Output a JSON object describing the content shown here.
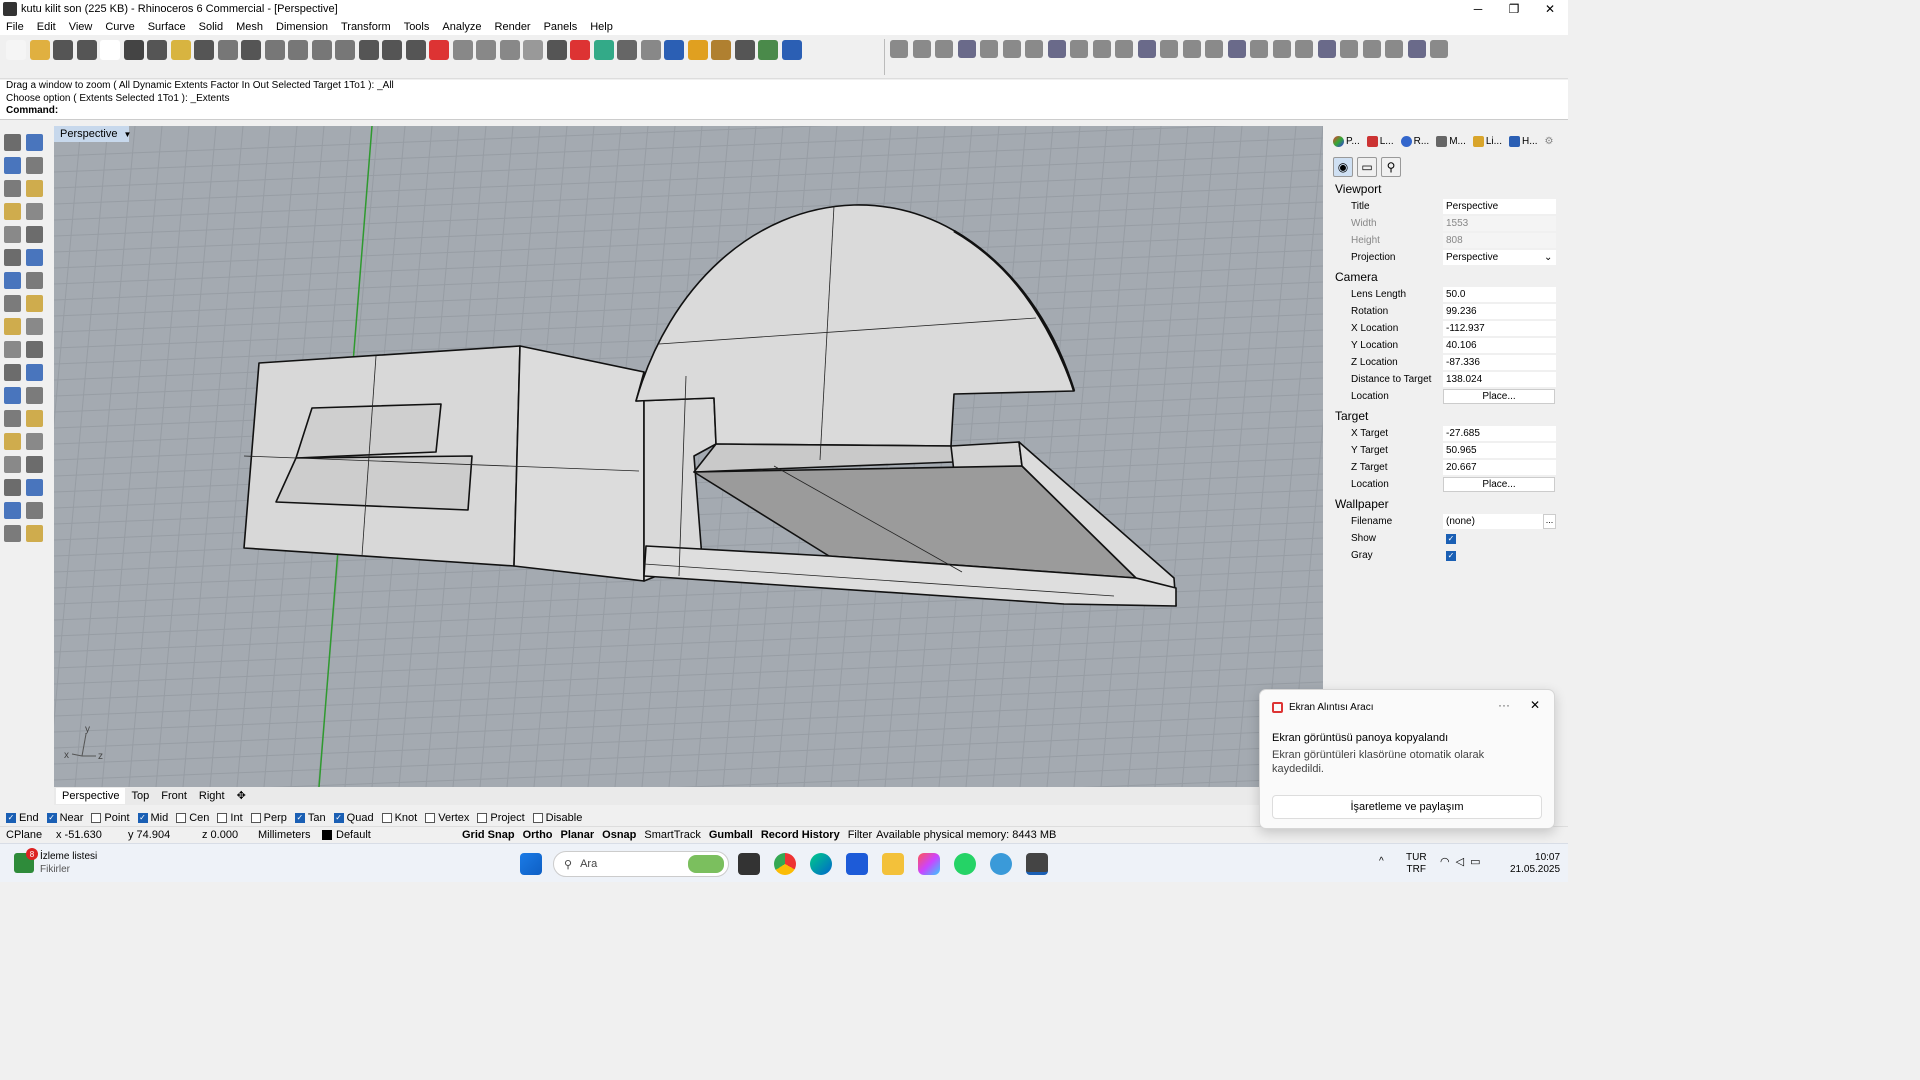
{
  "window": {
    "title": "kutu kilit son (225 KB) - Rhinoceros 6 Commercial - [Perspective]",
    "controls": [
      "─",
      "❐",
      "✕"
    ]
  },
  "menu": [
    "File",
    "Edit",
    "View",
    "Curve",
    "Surface",
    "Solid",
    "Mesh",
    "Dimension",
    "Transform",
    "Tools",
    "Analyze",
    "Render",
    "Panels",
    "Help"
  ],
  "command": {
    "line1": "Drag a window to zoom ( All  Dynamic  Extents  Factor  In  Out  Selected  Target  1To1 ): _All",
    "line2": "Choose option ( Extents  Selected  1To1 ): _Extents",
    "label": "Command:"
  },
  "viewport": {
    "active_tab": "Perspective",
    "tabs": [
      "Perspective",
      "Top",
      "Front",
      "Right"
    ],
    "add_tab": "✥",
    "axis_labels": {
      "y": "y",
      "x": "x",
      "z": "z"
    }
  },
  "osnap": [
    {
      "label": "End",
      "checked": true
    },
    {
      "label": "Near",
      "checked": true
    },
    {
      "label": "Point",
      "checked": false
    },
    {
      "label": "Mid",
      "checked": true
    },
    {
      "label": "Cen",
      "checked": false
    },
    {
      "label": "Int",
      "checked": false
    },
    {
      "label": "Perp",
      "checked": false
    },
    {
      "label": "Tan",
      "checked": true
    },
    {
      "label": "Quad",
      "checked": true
    },
    {
      "label": "Knot",
      "checked": false
    },
    {
      "label": "Vertex",
      "checked": false
    },
    {
      "label": "Project",
      "checked": false
    },
    {
      "label": "Disable",
      "checked": false
    }
  ],
  "status": {
    "cplane": "CPlane",
    "x": "x -51.630",
    "y": "y 74.904",
    "z": "z 0.000",
    "units": "Millimeters",
    "layer": "Default",
    "buttons": [
      "Grid Snap",
      "Ortho",
      "Planar",
      "Osnap",
      "SmartTrack",
      "Gumball",
      "Record History",
      "Filter"
    ],
    "memory": "Available physical memory: 8443 MB"
  },
  "panel": {
    "tabs": [
      "P...",
      "L...",
      "R...",
      "M...",
      "Li...",
      "H..."
    ],
    "viewport_heading": "Viewport",
    "viewport_rows": [
      {
        "label": "Title",
        "value": "Perspective",
        "readonly": false
      },
      {
        "label": "Width",
        "value": "1553",
        "readonly": true
      },
      {
        "label": "Height",
        "value": "808",
        "readonly": true
      },
      {
        "label": "Projection",
        "value": "Perspective",
        "readonly": false
      }
    ],
    "camera_heading": "Camera",
    "camera_rows": [
      {
        "label": "Lens Length",
        "value": "50.0"
      },
      {
        "label": "Rotation",
        "value": "99.236"
      },
      {
        "label": "X Location",
        "value": "-112.937"
      },
      {
        "label": "Y Location",
        "value": "40.106"
      },
      {
        "label": "Z Location",
        "value": "-87.336"
      },
      {
        "label": "Distance to Target",
        "value": "138.024"
      }
    ],
    "camera_location_label": "Location",
    "camera_location_button": "Place...",
    "target_heading": "Target",
    "target_rows": [
      {
        "label": "X Target",
        "value": "-27.685"
      },
      {
        "label": "Y Target",
        "value": "50.965"
      },
      {
        "label": "Z Target",
        "value": "20.667"
      }
    ],
    "target_location_label": "Location",
    "target_location_button": "Place...",
    "wallpaper_heading": "Wallpaper",
    "filename_label": "Filename",
    "filename_value": "(none)",
    "filename_button": "...",
    "show_label": "Show",
    "show_checked": true,
    "gray_label": "Gray",
    "gray_checked": true
  },
  "toast": {
    "app": "Ekran Alıntısı Aracı",
    "more": "···",
    "close": "✕",
    "title": "Ekran görüntüsü panoya kopyalandı",
    "body": "Ekran görüntüleri klasörüne otomatik olarak kaydedildi.",
    "button": "İşaretleme ve paylaşım"
  },
  "taskbar": {
    "widget_title": "İzleme listesi",
    "widget_sub": "Fikirler",
    "widget_badge": "8",
    "search_placeholder": "Ara",
    "tray_chevron": "^",
    "lang1": "TUR",
    "lang2": "TRF",
    "time": "10:07",
    "date": "21.05.2025"
  },
  "colors": {
    "viewport_bg": "#a4aab1",
    "grid_line": "#969ca3",
    "model_face": "#d9d9d9",
    "model_face_dark": "#9a9a9a",
    "accent": "#1a5fb4"
  }
}
